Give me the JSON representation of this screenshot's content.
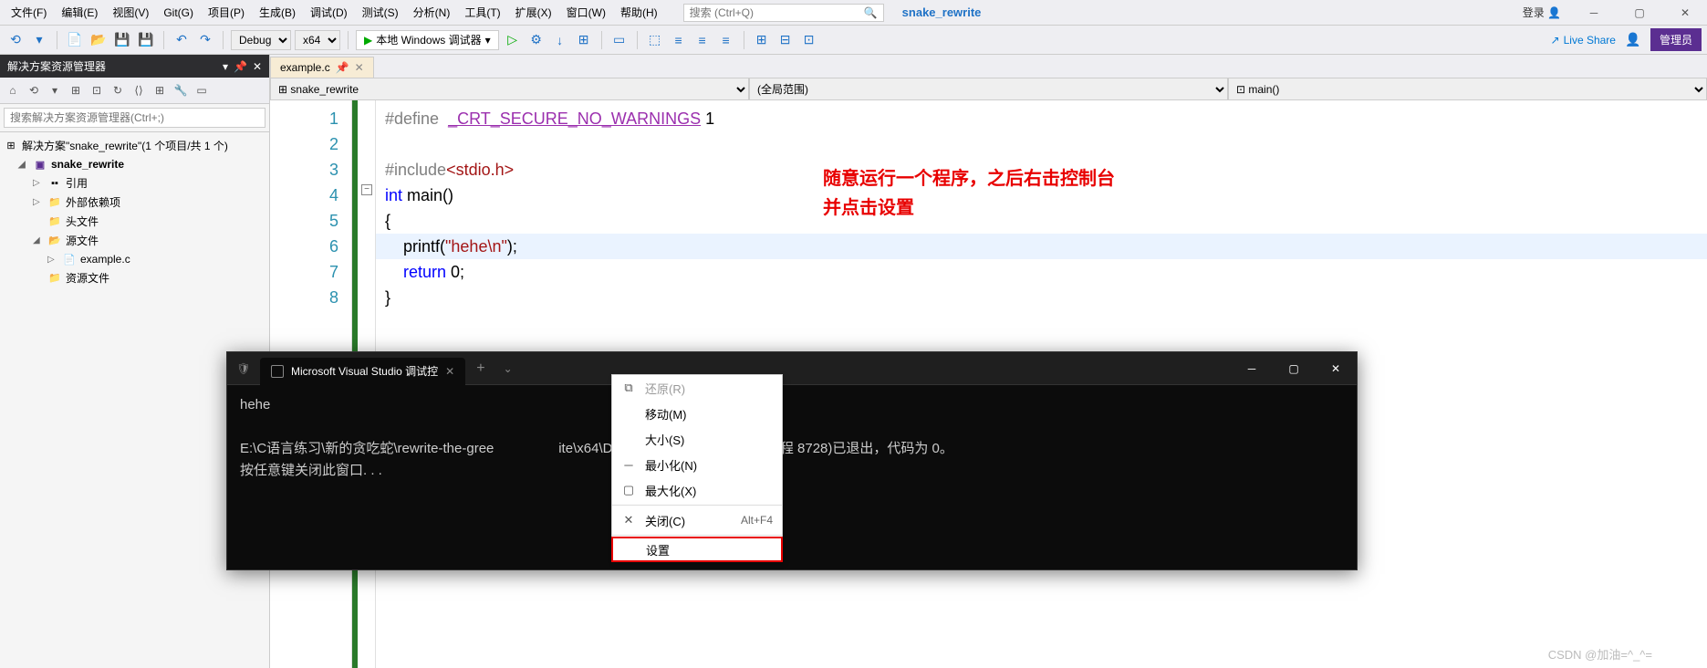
{
  "menu": {
    "items": [
      "文件(F)",
      "编辑(E)",
      "视图(V)",
      "Git(G)",
      "项目(P)",
      "生成(B)",
      "调试(D)",
      "测试(S)",
      "分析(N)",
      "工具(T)",
      "扩展(X)",
      "窗口(W)",
      "帮助(H)"
    ],
    "search_placeholder": "搜索 (Ctrl+Q)",
    "project_name": "snake_rewrite",
    "login": "登录",
    "admin": "管理员"
  },
  "toolbar": {
    "config": "Debug",
    "platform": "x64",
    "debugger": "本地 Windows 调试器",
    "live_share": "Live Share"
  },
  "solution": {
    "title": "解决方案资源管理器",
    "search_placeholder": "搜索解决方案资源管理器(Ctrl+;)",
    "root": "解决方案\"snake_rewrite\"(1 个项目/共 1 个)",
    "project": "snake_rewrite",
    "refs": "引用",
    "external": "外部依赖项",
    "headers": "头文件",
    "sources": "源文件",
    "file": "example.c",
    "resources": "资源文件"
  },
  "editor": {
    "tab": "example.c",
    "nav1": "snake_rewrite",
    "nav2": "(全局范围)",
    "nav3": "main()",
    "lines": [
      "1",
      "2",
      "3",
      "4",
      "5",
      "6",
      "7",
      "8"
    ],
    "code": {
      "l1a": "#define  ",
      "l1b": "_CRT_SECURE_NO_WARNINGS",
      "l1c": " 1",
      "l3a": "#include",
      "l3b": "<stdio.h>",
      "l4a": "int",
      "l4b": " main()",
      "l5": "{",
      "l6a": "    printf(",
      "l6b": "\"hehe\\n\"",
      "l6c": ");",
      "l7a": "    ",
      "l7b": "return",
      "l7c": " 0;",
      "l8": "}"
    },
    "annotation_l1": "随意运行一个程序，之后右击控制台",
    "annotation_l2": "并点击设置"
  },
  "terminal": {
    "tab_title": "Microsoft Visual Studio 调试控",
    "body_l1": "hehe",
    "body_l2": "E:\\C语言练习\\新的贪吃蛇\\rewrite-the-gree                 ite\\x64\\Debug\\snake_rewrite.exe (进程 8728)已退出，代码为 0。",
    "body_l3": "按任意键关闭此窗口. . ."
  },
  "context_menu": {
    "restore": "还原(R)",
    "move": "移动(M)",
    "size": "大小(S)",
    "minimize": "最小化(N)",
    "maximize": "最大化(X)",
    "close": "关闭(C)",
    "close_sc": "Alt+F4",
    "settings": "设置"
  },
  "watermark": "CSDN @加油=^_^="
}
